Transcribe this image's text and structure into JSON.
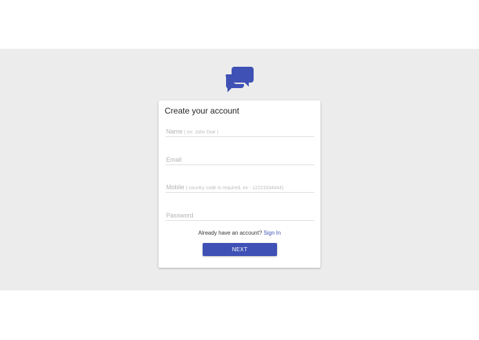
{
  "brand": {
    "logo_icon": "chat-bubbles-icon",
    "accent_color": "#3f51b5"
  },
  "form": {
    "title": "Create your account",
    "fields": [
      {
        "placeholder": "Name",
        "hint": "( ex: John Doe )",
        "value": ""
      },
      {
        "placeholder": "Email",
        "hint": "",
        "value": ""
      },
      {
        "placeholder": "Mobile",
        "hint": "( country code is required, ex - 12223334444)",
        "value": ""
      },
      {
        "placeholder": "Password",
        "hint": "",
        "value": ""
      }
    ],
    "signin_prompt": "Already have an account?",
    "signin_link": "Sign In",
    "next_label": "NEXT"
  }
}
